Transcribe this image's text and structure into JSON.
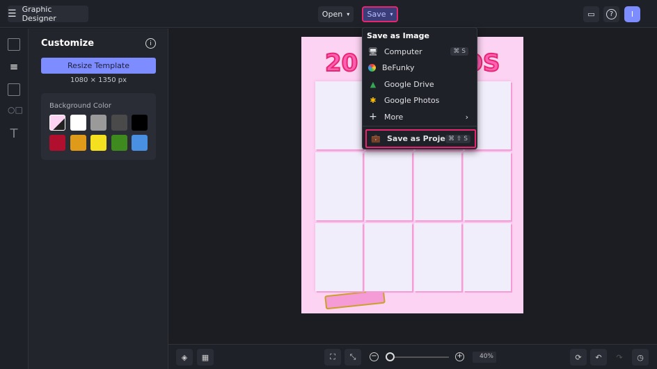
{
  "app": {
    "title": "Graphic Designer"
  },
  "header": {
    "open_label": "Open",
    "save_label": "Save"
  },
  "panel": {
    "title": "Customize",
    "resize_label": "Resize Template",
    "size": "1080 × 1350 px",
    "bg_label": "Background Color",
    "swatches": [
      "#fcd3f3",
      "#ffffff",
      "#9a9a9a",
      "#4a4a4a",
      "#000000",
      "#b0102e",
      "#e09a1a",
      "#f5e01f",
      "#3f8a1f",
      "#4a90e2"
    ]
  },
  "menu": {
    "section": "Save as Image",
    "items": [
      {
        "label": "Computer",
        "shortcut": "⌘ S"
      },
      {
        "label": "BeFunky"
      },
      {
        "label": "Google Drive"
      },
      {
        "label": "Google Photos"
      },
      {
        "label": "More"
      }
    ],
    "project": {
      "label": "Save as Project",
      "shortcut": "⌘ ⇧ S"
    }
  },
  "poster": {
    "title_left": "20",
    "title_right": "OS"
  },
  "bottom": {
    "zoom": "40%",
    "zoom_fraction": 0.05
  },
  "colors": {
    "accent": "#7d8cff",
    "highlight": "#e8266f"
  }
}
